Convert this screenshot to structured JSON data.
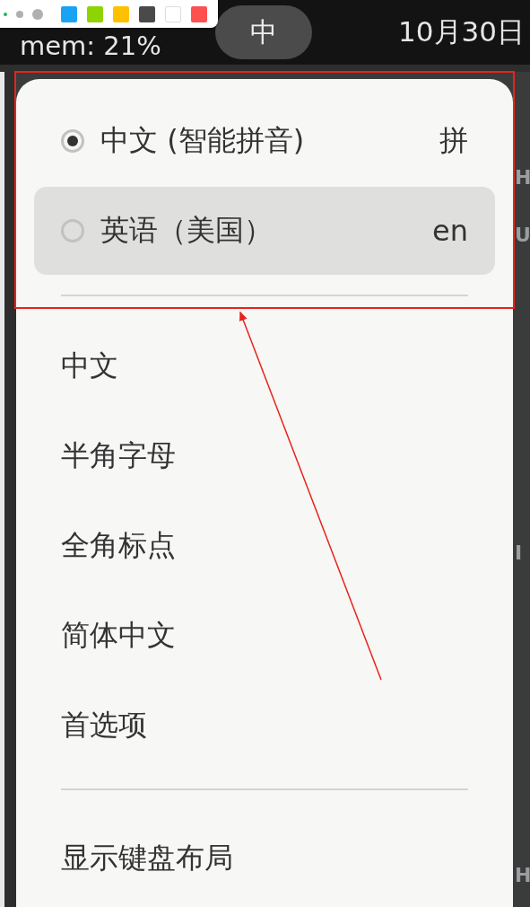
{
  "top_bar": {
    "status_text": "mem: 21%",
    "input_indicator": "中",
    "date": "10月30日"
  },
  "annotation_toolbar": {
    "pen_sizes": [
      {
        "selected": true
      },
      {
        "selected": false
      },
      {
        "selected": false
      }
    ],
    "swatches": [
      {
        "color": "#1aa3f5"
      },
      {
        "color": "#8fd400"
      },
      {
        "color": "#ffc000"
      },
      {
        "color": "#4a4a4a"
      },
      {
        "color": "#ffffff"
      },
      {
        "color": "#ff5050"
      }
    ]
  },
  "menu": {
    "input_methods": [
      {
        "label": "中文 (智能拼音)",
        "indicator": "拼",
        "selected": true,
        "highlighted": false
      },
      {
        "label": "英语（美国）",
        "indicator": "en",
        "selected": false,
        "highlighted": true
      }
    ],
    "options": [
      "中文",
      "半角字母",
      "全角标点",
      "简体中文",
      "首选项"
    ],
    "footer_items": [
      "显示键盘布局"
    ]
  },
  "background_fragments": [
    "H",
    "U",
    "I",
    "H"
  ]
}
